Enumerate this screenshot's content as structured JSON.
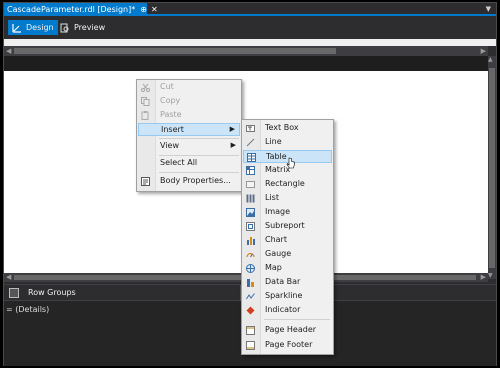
{
  "colors": {
    "accent": "#007acc",
    "menu_highlight": "#cce4f7",
    "dark": "#2d2d30"
  },
  "doc_tab": {
    "title": "CascadeParameter.rdl [Design]*",
    "pin": "⊕",
    "close": "✕"
  },
  "view_tabs": [
    {
      "label": "Design",
      "icon": "design-icon",
      "active": true
    },
    {
      "label": "Preview",
      "icon": "preview-icon",
      "active": false
    }
  ],
  "context_menu": {
    "items": [
      {
        "label": "Cut",
        "icon": "cut-icon",
        "enabled": false
      },
      {
        "label": "Copy",
        "icon": "copy-icon",
        "enabled": false
      },
      {
        "label": "Paste",
        "icon": "paste-icon",
        "enabled": false
      },
      {
        "label": "Insert",
        "submenu": true,
        "highlighted": true
      },
      {
        "label": "View",
        "submenu": true
      },
      {
        "label": "Select All"
      },
      {
        "label": "Body Properties...",
        "icon": "properties-icon"
      }
    ]
  },
  "insert_submenu": {
    "items": [
      {
        "label": "Text Box",
        "icon": "textbox-icon"
      },
      {
        "label": "Line",
        "icon": "line-icon"
      },
      {
        "label": "Table",
        "icon": "table-icon",
        "highlighted": true
      },
      {
        "label": "Matrix",
        "icon": "matrix-icon"
      },
      {
        "label": "Rectangle",
        "icon": "rectangle-icon"
      },
      {
        "label": "List",
        "icon": "list-icon"
      },
      {
        "label": "Image",
        "icon": "image-icon"
      },
      {
        "label": "Subreport",
        "icon": "subreport-icon"
      },
      {
        "label": "Chart",
        "icon": "chart-icon"
      },
      {
        "label": "Gauge",
        "icon": "gauge-icon"
      },
      {
        "label": "Map",
        "icon": "map-icon"
      },
      {
        "label": "Data Bar",
        "icon": "databar-icon"
      },
      {
        "label": "Sparkline",
        "icon": "sparkline-icon"
      },
      {
        "label": "Indicator",
        "icon": "indicator-icon"
      },
      {
        "label": "Page Header",
        "icon": "page-header-icon"
      },
      {
        "label": "Page Footer",
        "icon": "page-footer-icon"
      }
    ]
  },
  "grouping": {
    "row_groups_label": "Row Groups",
    "details_label": "= (Details)"
  }
}
